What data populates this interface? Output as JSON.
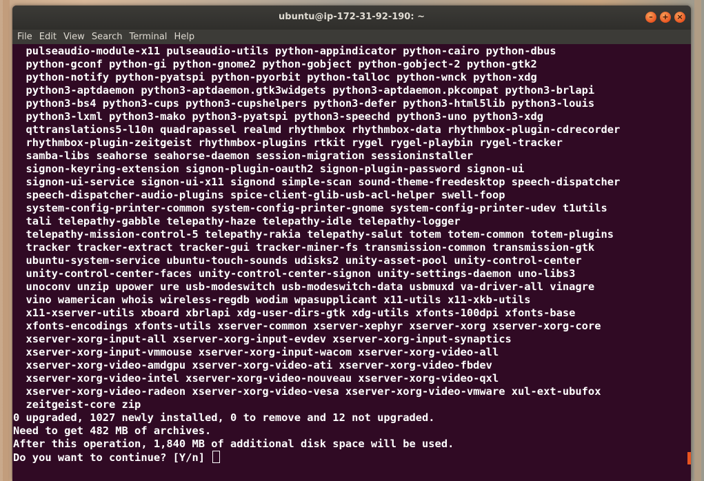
{
  "window": {
    "title": "ubuntu@ip-172-31-92-190: ~"
  },
  "window_buttons": {
    "minimize": "–",
    "maximize": "+",
    "close": "×"
  },
  "menu": [
    "File",
    "Edit",
    "View",
    "Search",
    "Terminal",
    "Help"
  ],
  "terminal_lines": [
    "  pulseaudio-module-x11 pulseaudio-utils python-appindicator python-cairo python-dbus",
    "  python-gconf python-gi python-gnome2 python-gobject python-gobject-2 python-gtk2",
    "  python-notify python-pyatspi python-pyorbit python-talloc python-wnck python-xdg",
    "  python3-aptdaemon python3-aptdaemon.gtk3widgets python3-aptdaemon.pkcompat python3-brlapi",
    "  python3-bs4 python3-cups python3-cupshelpers python3-defer python3-html5lib python3-louis",
    "  python3-lxml python3-mako python3-pyatspi python3-speechd python3-uno python3-xdg",
    "  qttranslations5-l10n quadrapassel realmd rhythmbox rhythmbox-data rhythmbox-plugin-cdrecorder",
    "  rhythmbox-plugin-zeitgeist rhythmbox-plugins rtkit rygel rygel-playbin rygel-tracker",
    "  samba-libs seahorse seahorse-daemon session-migration sessioninstaller",
    "  signon-keyring-extension signon-plugin-oauth2 signon-plugin-password signon-ui",
    "  signon-ui-service signon-ui-x11 signond simple-scan sound-theme-freedesktop speech-dispatcher",
    "  speech-dispatcher-audio-plugins spice-client-glib-usb-acl-helper swell-foop",
    "  system-config-printer-common system-config-printer-gnome system-config-printer-udev t1utils",
    "  tali telepathy-gabble telepathy-haze telepathy-idle telepathy-logger",
    "  telepathy-mission-control-5 telepathy-rakia telepathy-salut totem totem-common totem-plugins",
    "  tracker tracker-extract tracker-gui tracker-miner-fs transmission-common transmission-gtk",
    "  ubuntu-system-service ubuntu-touch-sounds udisks2 unity-asset-pool unity-control-center",
    "  unity-control-center-faces unity-control-center-signon unity-settings-daemon uno-libs3",
    "  unoconv unzip upower ure usb-modeswitch usb-modeswitch-data usbmuxd va-driver-all vinagre",
    "  vino wamerican whois wireless-regdb wodim wpasupplicant x11-utils x11-xkb-utils",
    "  x11-xserver-utils xboard xbrlapi xdg-user-dirs-gtk xdg-utils xfonts-100dpi xfonts-base",
    "  xfonts-encodings xfonts-utils xserver-common xserver-xephyr xserver-xorg xserver-xorg-core",
    "  xserver-xorg-input-all xserver-xorg-input-evdev xserver-xorg-input-synaptics",
    "  xserver-xorg-input-vmmouse xserver-xorg-input-wacom xserver-xorg-video-all",
    "  xserver-xorg-video-amdgpu xserver-xorg-video-ati xserver-xorg-video-fbdev",
    "  xserver-xorg-video-intel xserver-xorg-video-nouveau xserver-xorg-video-qxl",
    "  xserver-xorg-video-radeon xserver-xorg-video-vesa xserver-xorg-video-vmware xul-ext-ubufox",
    "  zeitgeist-core zip",
    "0 upgraded, 1027 newly installed, 0 to remove and 12 not upgraded.",
    "Need to get 482 MB of archives.",
    "After this operation, 1,840 MB of additional disk space will be used."
  ],
  "prompt": "Do you want to continue? [Y/n] ",
  "colors": {
    "terminal_bg": "#300a24",
    "terminal_fg": "#ffffff",
    "titlebar": "#3c3b37",
    "accent": "#e95420"
  },
  "icons": {
    "cursor": "block-cursor-icon"
  }
}
